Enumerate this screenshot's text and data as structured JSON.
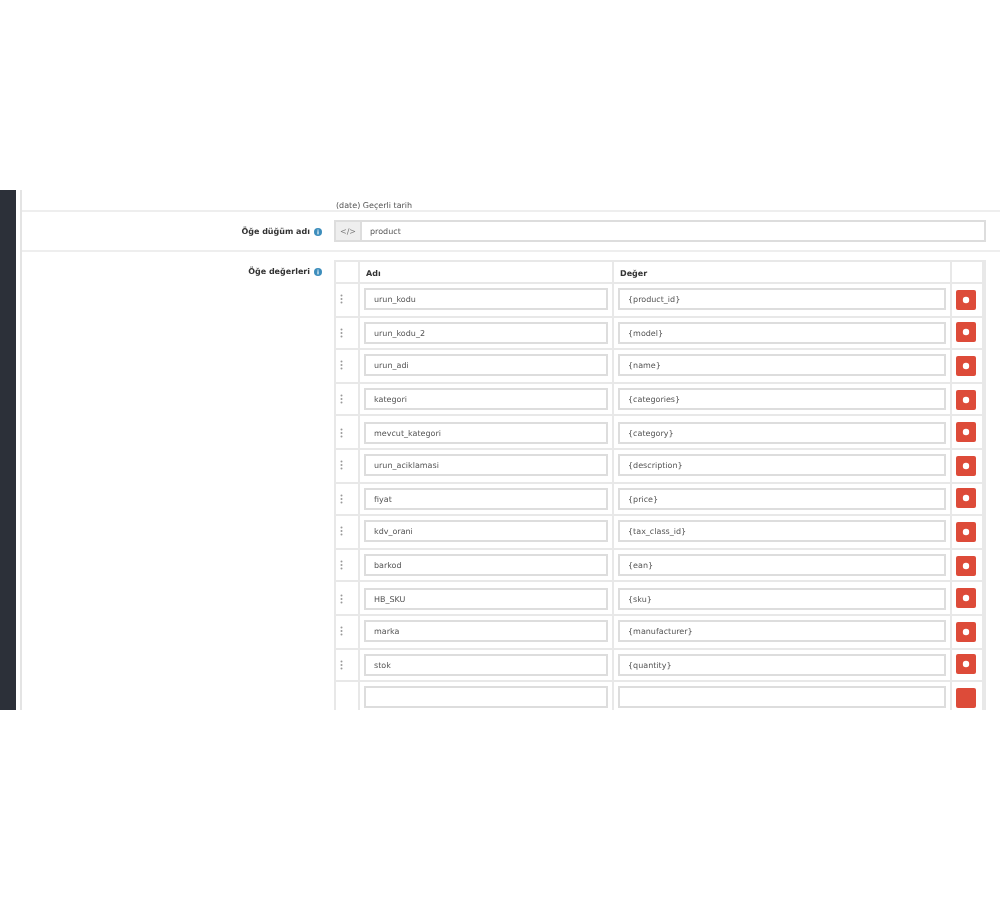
{
  "note": "(date) Geçerli tarih",
  "node_field": {
    "label": "Öğe düğüm adı",
    "addon": "</>",
    "value": "product"
  },
  "values_field": {
    "label": "Öğe değerleri",
    "columns": [
      "Adı",
      "Değer"
    ],
    "rows": [
      {
        "kind": "row",
        "name": "urun_kodu",
        "value": "{product_id}"
      },
      {
        "kind": "row",
        "name": "urun_kodu_2",
        "value": "{model}"
      },
      {
        "kind": "row",
        "name": "urun_adi",
        "value": "{name}"
      },
      {
        "kind": "row",
        "name": "kategori",
        "value": "{categories}"
      },
      {
        "kind": "row",
        "name": "mevcut_kategori",
        "value": "{category}"
      },
      {
        "kind": "row",
        "name": "urun_aciklamasi",
        "value": "{description}"
      },
      {
        "kind": "row",
        "name": "fiyat",
        "value": "{price}"
      },
      {
        "kind": "row",
        "name": "kdv_orani",
        "value": "{tax_class_id}"
      },
      {
        "kind": "row",
        "name": "barkod",
        "value": "{ean}"
      },
      {
        "kind": "row",
        "name": "HB_SKU",
        "value": "{sku}"
      },
      {
        "kind": "row",
        "name": "marka",
        "value": "{manufacturer}"
      },
      {
        "kind": "row",
        "name": "stok",
        "value": "{quantity}"
      },
      {
        "kind": "clipped"
      }
    ]
  }
}
